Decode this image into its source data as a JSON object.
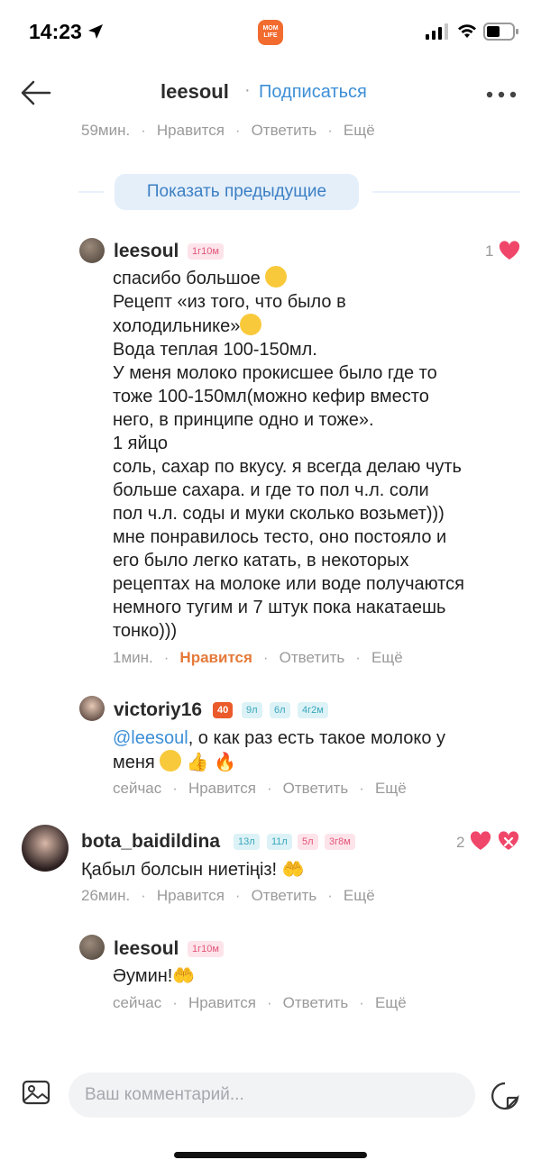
{
  "status_bar": {
    "time": "14:23",
    "app_logo_text": "MOM LIFE"
  },
  "header": {
    "username": "leesoul",
    "separator": "·",
    "subscribe_label": "Подписаться"
  },
  "top_meta": {
    "time": "59мин.",
    "like": "Нравится",
    "reply": "Ответить",
    "more": "Ещё"
  },
  "show_previous": "Показать предыдущие",
  "comments": [
    {
      "username": "leesoul",
      "badges": [
        "1г10м"
      ],
      "likes": "1",
      "lines": [
        "спасибо большое",
        "Рецепт «из того, что было в",
        "холодильнике»",
        "Вода теплая 100-150мл.",
        "У меня молоко прокисшее было где то",
        "тоже 100-150мл(можно кефир вместо",
        "него, в принципе одно и тоже».",
        "1 яйцо",
        "соль, сахар по вкусу. я всегда делаю чуть",
        "больше сахара. и где то пол ч.л. соли",
        "пол ч.л. соды и муки сколько возьмет)))",
        "мне понравилось тесто, оно постояло и",
        "его было легко катать, в некоторых",
        "рецептах на молоке или воде получаются",
        "немного тугим и 7 штук пока накатаешь",
        "тонко)))"
      ],
      "meta": {
        "time": "1мин.",
        "like": "Нравится",
        "reply": "Ответить",
        "more": "Ещё"
      }
    },
    {
      "username": "victoriy16",
      "badges": [
        "40",
        "9л",
        "6л",
        "4г2м"
      ],
      "mention": "@leesoul",
      "line1_rest": ", о как раз есть такое молоко у",
      "line2": "меня",
      "meta": {
        "time": "сейчас",
        "like": "Нравится",
        "reply": "Ответить",
        "more": "Ещё"
      }
    },
    {
      "username": "bota_baidildina",
      "badges": [
        "13л",
        "11л",
        "5л",
        "3г8м"
      ],
      "likes": "2",
      "text": "Қабыл болсын ниетіңіз!",
      "meta": {
        "time": "26мин.",
        "like": "Нравится",
        "reply": "Ответить",
        "more": "Ещё"
      }
    },
    {
      "username": "leesoul",
      "badges": [
        "1г10м"
      ],
      "text": "Әумин!",
      "meta": {
        "time": "сейчас",
        "like": "Нравится",
        "reply": "Ответить",
        "more": "Ещё"
      }
    }
  ],
  "composer": {
    "placeholder": "Ваш комментарий..."
  },
  "colors": {
    "accent_blue": "#3d8fd6",
    "like_orange": "#e57a3a",
    "heart": "#f0466a",
    "badge_orange": "#ea5a2b"
  },
  "icons": [
    "location-arrow-icon",
    "signal-icon",
    "wifi-icon",
    "battery-icon",
    "back-arrow-icon",
    "more-icon",
    "heart-icon",
    "heart-broken-icon",
    "image-icon",
    "sticker-icon"
  ]
}
